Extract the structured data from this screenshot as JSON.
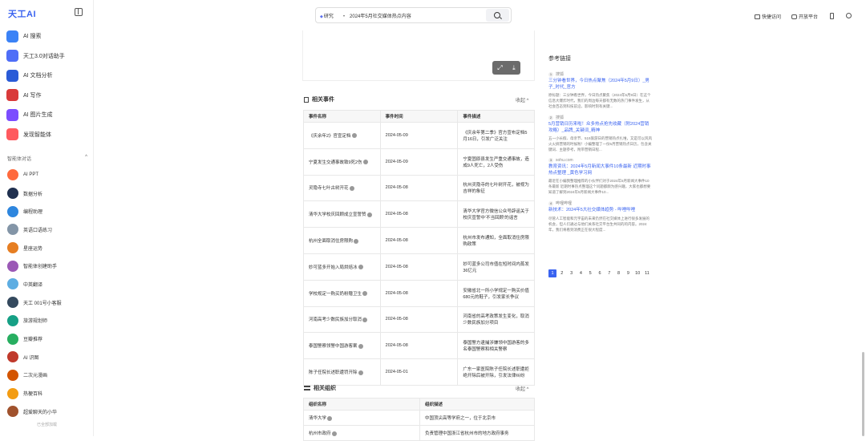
{
  "app": {
    "logo": "天工AI"
  },
  "nav": [
    {
      "label": "AI 搜索",
      "color": "#3b82f6"
    },
    {
      "label": "天工3.0对话助手",
      "color": "#4f6ef7"
    },
    {
      "label": "AI 文档分析",
      "color": "#2a5bd7"
    },
    {
      "label": "AI 写作",
      "color": "#d93a3a"
    },
    {
      "label": "AI 图片生成",
      "color": "#7c4dff"
    },
    {
      "label": "发现智能体",
      "color": "#ff5a5f"
    }
  ],
  "agents_header": {
    "label": "智能体对话",
    "chevron": "^"
  },
  "agents": [
    {
      "label": "AI PPT",
      "color": "#ff6a3d"
    },
    {
      "label": "数据分析",
      "color": "#20304f"
    },
    {
      "label": "编程助理",
      "color": "#2e86de"
    },
    {
      "label": "英语口语练习",
      "color": "#8395a7"
    },
    {
      "label": "星座运势",
      "color": "#e67e22"
    },
    {
      "label": "智能体创建助手",
      "color": "#9b59b6"
    },
    {
      "label": "中英翻译",
      "color": "#5dade2"
    },
    {
      "label": "天工 001号小客服",
      "color": "#34495e"
    },
    {
      "label": "旅游规划师",
      "color": "#16a085"
    },
    {
      "label": "豆瓣推荐",
      "color": "#27ae60"
    },
    {
      "label": "AI 识图",
      "color": "#c0392b"
    },
    {
      "label": "二次元漫画",
      "color": "#d35400"
    },
    {
      "label": "热梗百科",
      "color": "#f39c12"
    },
    {
      "label": "超爱聊天的小华",
      "color": "#a0522d"
    }
  ],
  "footer": "已全部加载",
  "search": {
    "mode": "研究",
    "query": "2024年5月社交媒体热点内容"
  },
  "top_right": [
    {
      "label": "快捷访问"
    },
    {
      "label": "开放平台"
    }
  ],
  "map_tools": {
    "expand": "⤢",
    "download": "⤓"
  },
  "events": {
    "title": "相关事件",
    "fold": "收起 ^",
    "headers": [
      "事件名称",
      "事件时间",
      "事件描述"
    ],
    "rows": [
      [
        "《庆余年2》官宣定档",
        "2024-05-09",
        "《庆余年第二季》官方宣布定档5月16日，引发广泛关注"
      ],
      [
        "宁夏发生交通事故致9死2伤",
        "2024-05-09",
        "宁夏固原县发生严重交通事故，造成9人死亡，2人受伤"
      ],
      [
        "灵隐寺七叶古树开花",
        "2024-05-08",
        "杭州灵隐寺的七叶树开花，被视为吉祥的象征"
      ],
      [
        "清华大学校庆回顾成立宣誓赞",
        "2024-05-08",
        "清华大学官方微信公众号辟谣关于校庆宣誓中‘不当回顾’的谣言"
      ],
      [
        "杭州全面取消住房限购",
        "2024-05-08",
        "杭州市发布通知，全面取消住房限购政策"
      ],
      [
        "妙可蓝多开始入局烘焙冰",
        "2024-05-08",
        "妙可蓝多公司市值在短时间内蒸发36亿元"
      ],
      [
        "学校规定一购买奶粉赠卫生",
        "2024-05-08",
        "安徽省北一所小学规定一购买价值680元的鞋子，引发家长争议"
      ],
      [
        "河南高考少数民族加分取消",
        "2024-05-08",
        "河南省的高考政策发生变化，取消少数民族加分项目"
      ],
      [
        "泰国警察领警中国游客案",
        "2024-05-08",
        "泰国警方逮捕涉嫌领中国游客的多名泰国警察和相关警察"
      ],
      [
        "陈子任院长述职遭罚开除",
        "2024-05-01",
        "广东一家医院陈子任院长述职遭拒绝开除后被开除，引发法律纠纷"
      ]
    ]
  },
  "orgs": {
    "title": "相关组织",
    "fold": "收起 ^",
    "headers": [
      "组织名称",
      "组织描述"
    ],
    "rows": [
      [
        "清华大学",
        "中国顶尖高等学府之一，位于北京市"
      ],
      [
        "杭州市政府",
        "负责管理中国浙江省杭州市的地方政府事务"
      ]
    ]
  },
  "refs": {
    "title": "参考链接",
    "items": [
      {
        "num": "1",
        "source": "搜狐",
        "title": "三分钟看世界，今日热点聚焦（2024年5月9日）_男子_时代_官方",
        "snippet": "原标题：三分钟看世界，今日热点聚焦（2024年5月9日）在这个信息大爆炸时代，我们的周边每天都有无数的热门事件发生，从社会百态到科技前沿，影响时刻有关键..."
      },
      {
        "num": "2",
        "source": "搜狐",
        "title": "5月营销日历来啦！众多热点抢先收藏（附2024营销攻略）_品牌_关键词_精神",
        "snippet": "五一小长假、母亲节、519旅游日的营销热点扎堆，又是可以风风火火搞营销的时候啦！小编整理了一份5月营销热点日历，包含关键词、主题参考，附带营销日程..."
      },
      {
        "num": "3",
        "source": "sohu.com",
        "title": "教育资讯：2024年5月新闻大事件10条最新 近期时事热点整理 _黄色学习网",
        "snippet": "最近在小编我整理推荐的小伙伴们对于2024年5月新闻大事件10条最新 近期时事热点整理这个问题都颇为感兴趣，大家也都想要知道了解到2024年5月新闻大事件10..."
      },
      {
        "num": "4",
        "source": "哔哩哔哩",
        "title": "新技术：2024年5大社交媒体趋势 - 哔哩哔哩",
        "snippet": "尽管人工智能和元宇宙的未来仍然在社交媒体上进行很多发展的机会，但人们通过与他们关系社交平台生共同的的内容。2024 年，我们将看到消费正在很大程度..."
      }
    ]
  },
  "pager": {
    "pages": [
      "1",
      "2",
      "3",
      "4",
      "5",
      "6",
      "7",
      "8",
      "9",
      "10",
      "11"
    ],
    "current": "1"
  }
}
